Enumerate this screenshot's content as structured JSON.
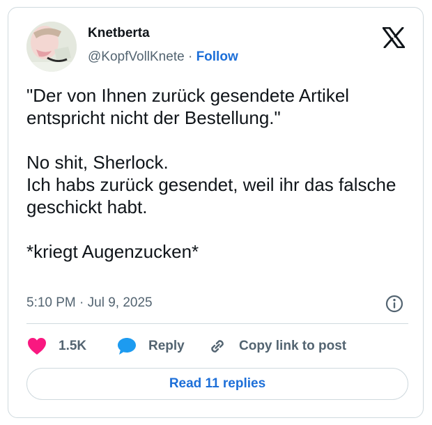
{
  "author": {
    "display_name": "Knetberta",
    "handle": "@KopfVollKnete",
    "separator": "·",
    "follow_label": "Follow"
  },
  "tweet": {
    "text": "\"Der von Ihnen zurück gesendete Artikel entspricht nicht der Bestellung.\"\n\nNo shit, Sherlock.\nIch habs zurück gesendet, weil ihr das falsche geschickt habt.\n\n*kriegt Augenzucken*",
    "time": "5:10 PM",
    "date_separator": "·",
    "date": "Jul 9, 2025"
  },
  "actions": {
    "like_count": "1.5K",
    "reply_label": "Reply",
    "copy_link_label": "Copy link to post"
  },
  "read_replies_label": "Read 11 replies",
  "icons": {
    "logo": "x-logo-icon",
    "info": "info-icon",
    "like": "heart-icon",
    "reply": "speech-bubble-icon",
    "copy": "link-icon"
  },
  "colors": {
    "like": "#f91880",
    "reply": "#1d9bf0",
    "link": "#1d6fd8",
    "muted": "#536471",
    "border": "#cfd9de"
  }
}
